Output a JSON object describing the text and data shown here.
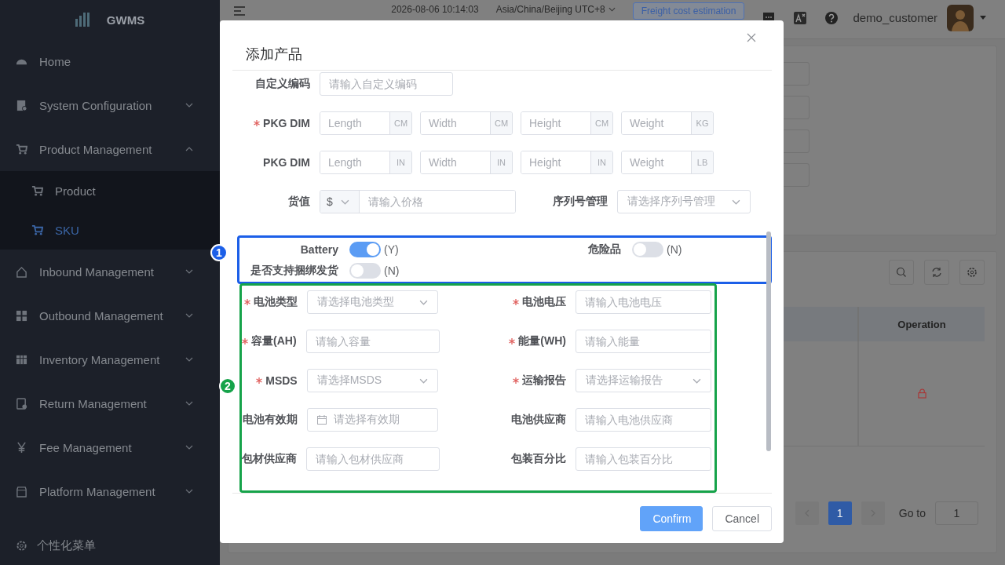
{
  "sidebar": {
    "logo": "GWMS",
    "items": [
      {
        "label": "Home"
      },
      {
        "label": "System Configuration",
        "expanded": false
      },
      {
        "label": "Product Management",
        "expanded": true,
        "children": [
          {
            "label": "Product",
            "selected": false
          },
          {
            "label": "SKU",
            "selected": true
          }
        ]
      },
      {
        "label": "Inbound Management",
        "expanded": false
      },
      {
        "label": "Outbound Management",
        "expanded": false
      },
      {
        "label": "Inventory Management",
        "expanded": false
      },
      {
        "label": "Return Management",
        "expanded": false
      },
      {
        "label": "Fee Management",
        "expanded": false
      },
      {
        "label": "Platform Management",
        "expanded": false
      }
    ],
    "footer": "个性化菜单"
  },
  "header": {
    "time": "2026-08-06 10:14:03",
    "timezone": "Asia/China/Beijing UTC+8",
    "estimate_button": "Freight cost estimation",
    "username": "demo_customer"
  },
  "table": {
    "columns": [
      "Operation"
    ]
  },
  "pagination": {
    "pages": [
      {
        "label": "1",
        "selected": true
      }
    ],
    "goto_label": "Go to",
    "goto_value": "1"
  },
  "dialog": {
    "title": "添加产品",
    "custom_code": {
      "label": "自定义编码",
      "placeholder": "请输入自定义编码"
    },
    "dims": [
      {
        "label": "PKG DIM",
        "required": true,
        "fields": [
          {
            "placeholder": "Length",
            "unit": "CM"
          },
          {
            "placeholder": "Width",
            "unit": "CM"
          },
          {
            "placeholder": "Height",
            "unit": "CM"
          },
          {
            "placeholder": "Weight",
            "unit": "KG"
          }
        ]
      },
      {
        "label": "PKG DIM",
        "required": false,
        "fields": [
          {
            "placeholder": "Length",
            "unit": "IN"
          },
          {
            "placeholder": "Width",
            "unit": "IN"
          },
          {
            "placeholder": "Height",
            "unit": "IN"
          },
          {
            "placeholder": "Weight",
            "unit": "LB"
          }
        ]
      }
    ],
    "value": {
      "label": "货值",
      "currency": "$",
      "placeholder": "请输入价格"
    },
    "serial": {
      "label": "序列号管理",
      "placeholder": "请选择序列号管理"
    },
    "switches": [
      {
        "label": "Battery",
        "on": true,
        "state_text": "(Y)"
      },
      {
        "label": "危险品",
        "on": false,
        "state_text": "(N)"
      },
      {
        "label": "是否支持捆绑发货",
        "on": false,
        "state_text": "(N)"
      }
    ],
    "battery_fields": [
      {
        "label": "电池类型",
        "required": true,
        "kind": "select",
        "placeholder": "请选择电池类型"
      },
      {
        "label": "电池电压",
        "required": true,
        "kind": "input",
        "placeholder": "请输入电池电压"
      },
      {
        "label": "容量(AH)",
        "required": true,
        "kind": "input",
        "placeholder": "请输入容量"
      },
      {
        "label": "能量(WH)",
        "required": true,
        "kind": "input",
        "placeholder": "请输入能量"
      },
      {
        "label": "MSDS",
        "required": true,
        "kind": "select",
        "placeholder": "请选择MSDS"
      },
      {
        "label": "运输报告",
        "required": true,
        "kind": "select",
        "placeholder": "请选择运输报告"
      },
      {
        "label": "电池有效期",
        "required": false,
        "kind": "date",
        "placeholder": "请选择有效期"
      },
      {
        "label": "电池供应商",
        "required": false,
        "kind": "input",
        "placeholder": "请输入电池供应商"
      },
      {
        "label": "包材供应商",
        "required": false,
        "kind": "input",
        "placeholder": "请输入包材供应商"
      },
      {
        "label": "包装百分比",
        "required": false,
        "kind": "input",
        "placeholder": "请输入包装百分比"
      }
    ],
    "buttons": [
      {
        "label": "Confirm",
        "kind": "primary"
      },
      {
        "label": "Cancel",
        "kind": "default"
      }
    ]
  },
  "annotations": [
    {
      "number": "1",
      "color": "#1c5fe8"
    },
    {
      "number": "2",
      "color": "#16a34a"
    }
  ]
}
